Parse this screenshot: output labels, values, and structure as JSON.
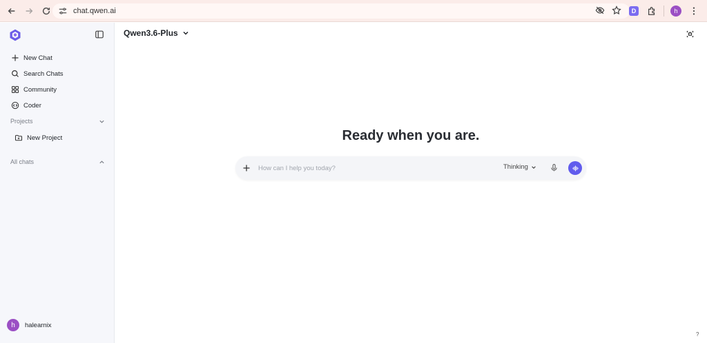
{
  "browser": {
    "url": "chat.qwen.ai",
    "extension_letter": "D",
    "profile_initial": "h"
  },
  "sidebar": {
    "items": [
      {
        "label": "New Chat",
        "icon": "plus-icon"
      },
      {
        "label": "Search Chats",
        "icon": "search-icon"
      },
      {
        "label": "Community",
        "icon": "grid-icon"
      },
      {
        "label": "Coder",
        "icon": "code-icon"
      }
    ],
    "projects_label": "Projects",
    "new_project_label": "New Project",
    "all_chats_label": "All chats",
    "user": {
      "initial": "h",
      "name": "halearnix"
    }
  },
  "main": {
    "model_name": "Qwen3.6-Plus",
    "hero_title": "Ready when you are.",
    "input_placeholder": "How can I help you today?",
    "thinking_label": "Thinking",
    "help_label": "?"
  },
  "colors": {
    "accent": "#615ced",
    "avatar": "#9b4fc4",
    "sidebar_bg": "#f6f7fb",
    "browser_bar": "#fbece9"
  }
}
